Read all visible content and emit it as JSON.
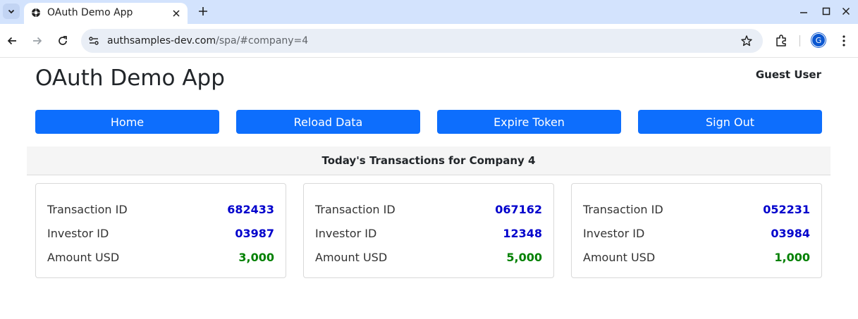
{
  "browser": {
    "tab_title": "OAuth Demo App",
    "url_host": "authsamples-dev.com",
    "url_path": "/spa/#company=4",
    "profile_initial": "G"
  },
  "app": {
    "title": "OAuth Demo App",
    "user": "Guest User"
  },
  "nav": {
    "home": "Home",
    "reload": "Reload Data",
    "expire": "Expire Token",
    "signout": "Sign Out"
  },
  "section": {
    "heading": "Today's Transactions for Company 4"
  },
  "labels": {
    "transaction_id": "Transaction ID",
    "investor_id": "Investor ID",
    "amount": "Amount USD"
  },
  "transactions": [
    {
      "transaction_id": "682433",
      "investor_id": "03987",
      "amount": "3,000"
    },
    {
      "transaction_id": "067162",
      "investor_id": "12348",
      "amount": "5,000"
    },
    {
      "transaction_id": "052231",
      "investor_id": "03984",
      "amount": "1,000"
    }
  ],
  "colors": {
    "button": "#0d6efd",
    "id_value": "#0000cc",
    "amount_value": "#008000"
  }
}
